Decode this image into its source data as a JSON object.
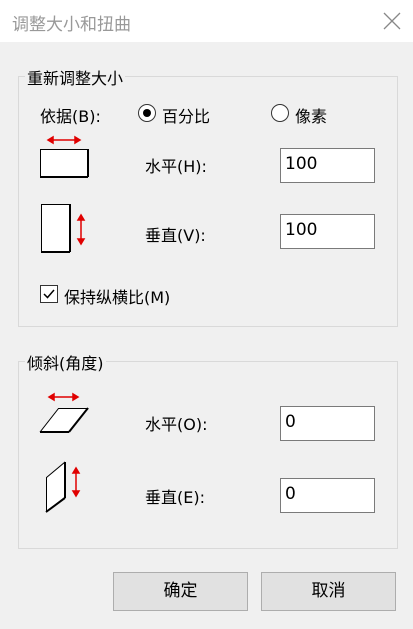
{
  "window": {
    "title": "调整大小和扭曲"
  },
  "resize": {
    "group_label": "重新调整大小",
    "basis_label": "依据(B):",
    "options": [
      {
        "label": "百分比",
        "selected": true
      },
      {
        "label": "像素",
        "selected": false
      }
    ],
    "horizontal_label": "水平(H):",
    "horizontal_value": "100",
    "vertical_label": "垂直(V):",
    "vertical_value": "100",
    "keep_ratio_label": "保持纵横比(M)",
    "keep_ratio_checked": true
  },
  "skew": {
    "group_label": "倾斜(角度)",
    "horizontal_label": "水平(O):",
    "horizontal_value": "0",
    "vertical_label": "垂直(E):",
    "vertical_value": "0"
  },
  "buttons": {
    "ok": "确定",
    "cancel": "取消"
  },
  "colors": {
    "arrow": "#e00000",
    "border": "#d9d9d9",
    "background": "#f0f0f0"
  },
  "icons": [
    "close-icon",
    "resize-horizontal-icon",
    "resize-vertical-icon",
    "skew-horizontal-icon",
    "skew-vertical-icon",
    "checkmark-icon"
  ]
}
